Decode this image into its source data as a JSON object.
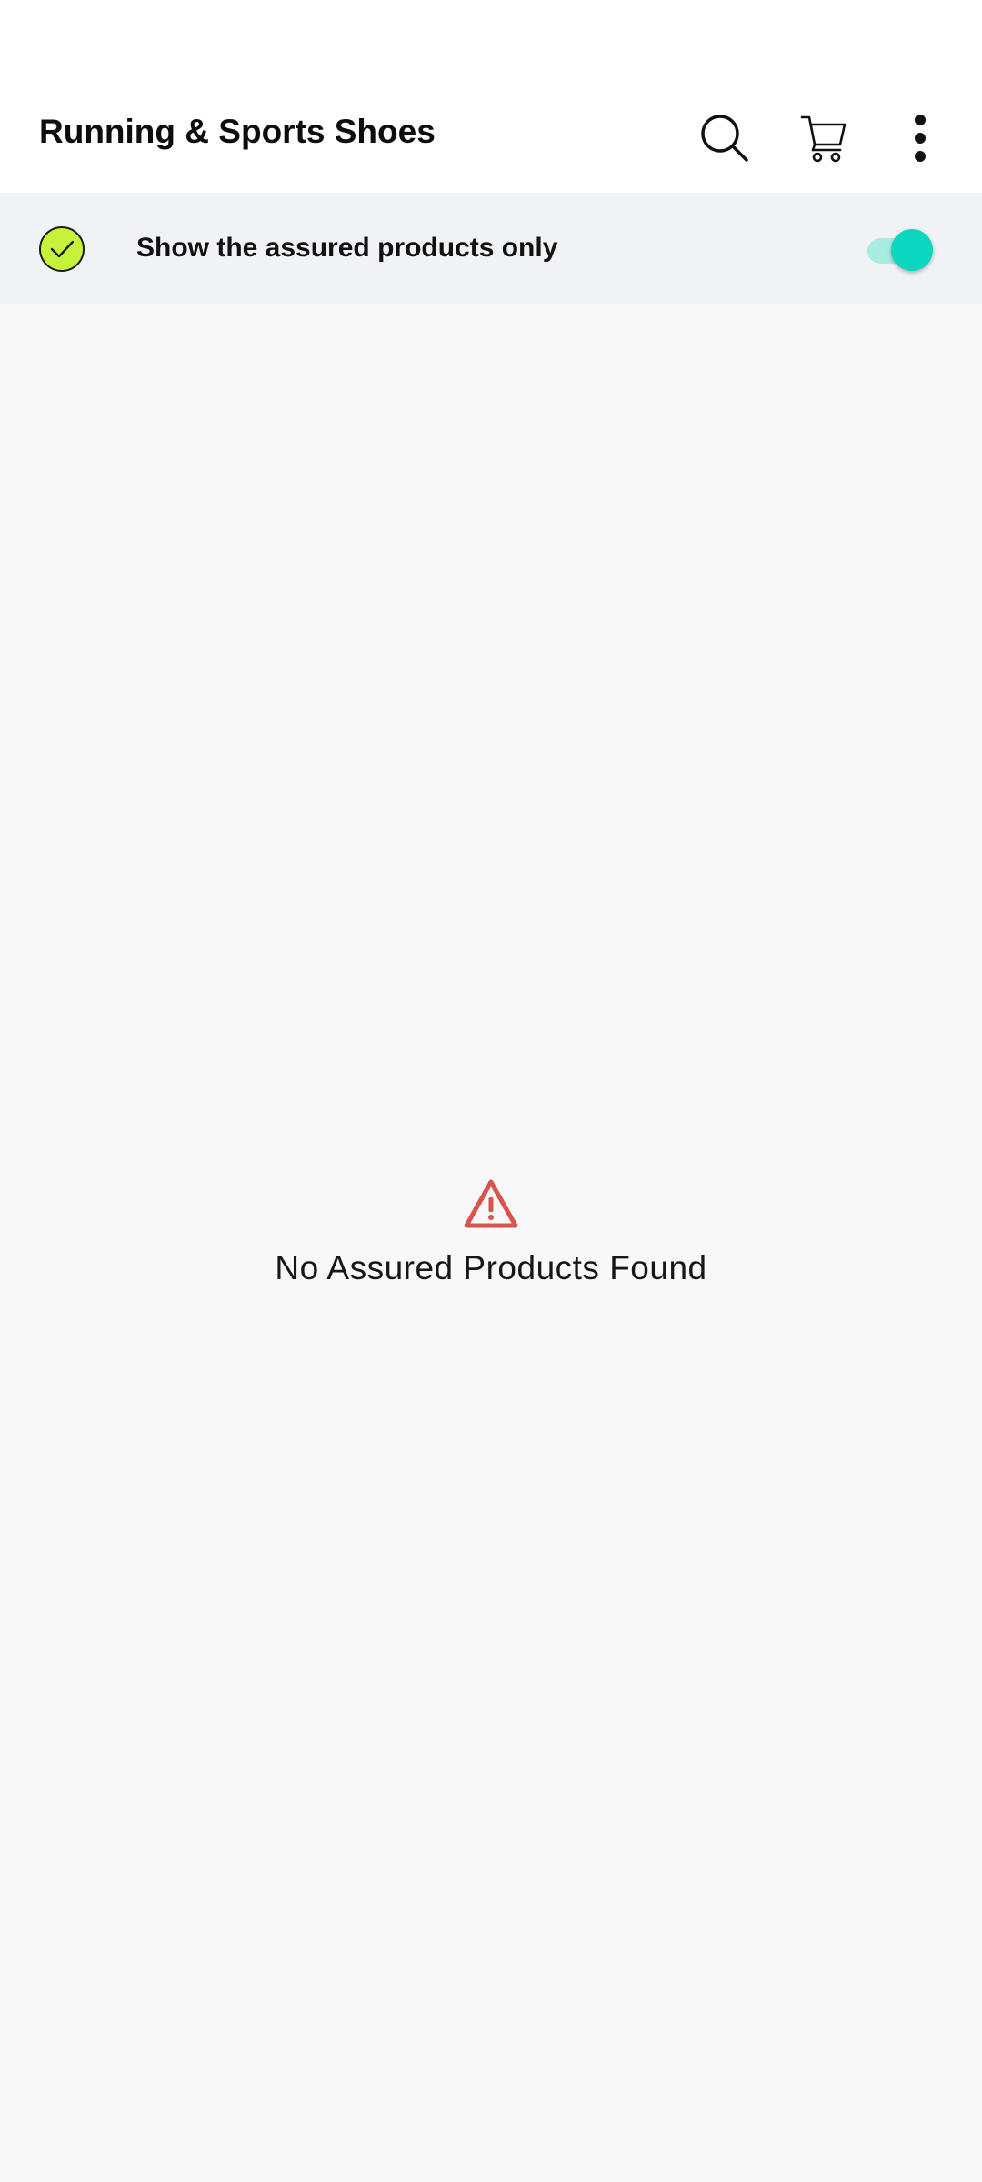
{
  "header": {
    "title": "Running & Sports Shoes",
    "icons": [
      "search-icon",
      "cart-icon",
      "more-vert-icon"
    ]
  },
  "filter": {
    "label": "Show the assured products only",
    "assured_badge_color": "#c6f339",
    "toggle_on": true,
    "toggle_color": "#0bd6be"
  },
  "empty_state": {
    "icon": "warning-icon",
    "icon_color": "#d9534f",
    "message": "No Assured Products Found"
  }
}
